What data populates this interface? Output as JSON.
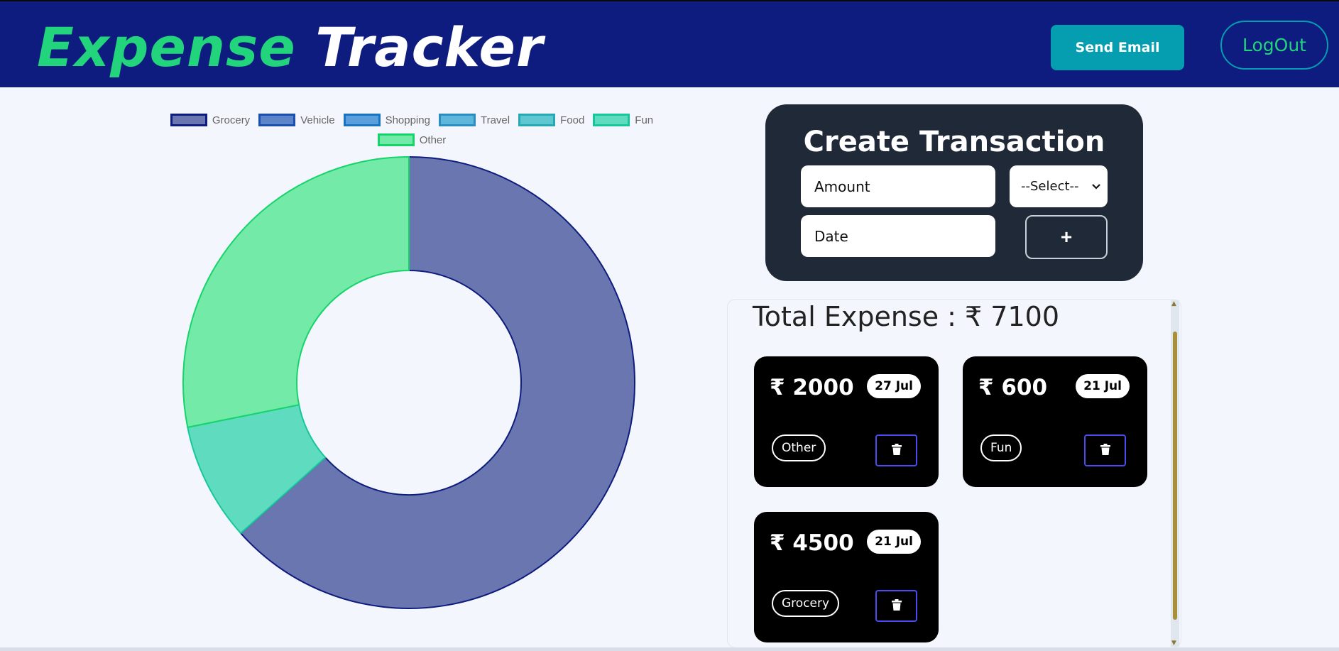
{
  "header": {
    "brand_part1": "Expense",
    "brand_part2": "Tracker",
    "send_email_label": "Send Email",
    "logout_label": "LogOut"
  },
  "colors": {
    "header_bg": "#0d1c7e",
    "brand_accent": "#22d47b",
    "button_teal": "#049eb0",
    "card_dark": "#1f2937"
  },
  "chart_data": {
    "type": "pie",
    "donut": true,
    "categories": [
      "Grocery",
      "Vehicle",
      "Shopping",
      "Travel",
      "Food",
      "Fun",
      "Other"
    ],
    "values": [
      4500,
      0,
      0,
      0,
      0,
      600,
      2000
    ],
    "colors": [
      "#6a76b0",
      "#5b84c9",
      "#5a9fdc",
      "#5fb6db",
      "#5fc7d2",
      "#5fdcc0",
      "#74eaa8"
    ],
    "borders": [
      "#0d1c7e",
      "#1a4fb0",
      "#1a73c0",
      "#2b8ec0",
      "#27a9b3",
      "#16c79a",
      "#16d46a"
    ],
    "legend_position": "top"
  },
  "create": {
    "title": "Create Transaction",
    "amount_placeholder": "Amount",
    "date_placeholder": "Date",
    "select_value": "--Select--",
    "add_label": "+"
  },
  "summary": {
    "total_label": "Total Expense : ₹ 7100"
  },
  "transactions": [
    {
      "amount": "₹ 2000",
      "date": "27 Jul",
      "category": "Other"
    },
    {
      "amount": "₹ 600",
      "date": "21 Jul",
      "category": "Fun"
    },
    {
      "amount": "₹ 4500",
      "date": "21 Jul",
      "category": "Grocery"
    }
  ],
  "icons": {
    "delete": "trash-icon",
    "select_arrow": "chevron-down-icon"
  }
}
